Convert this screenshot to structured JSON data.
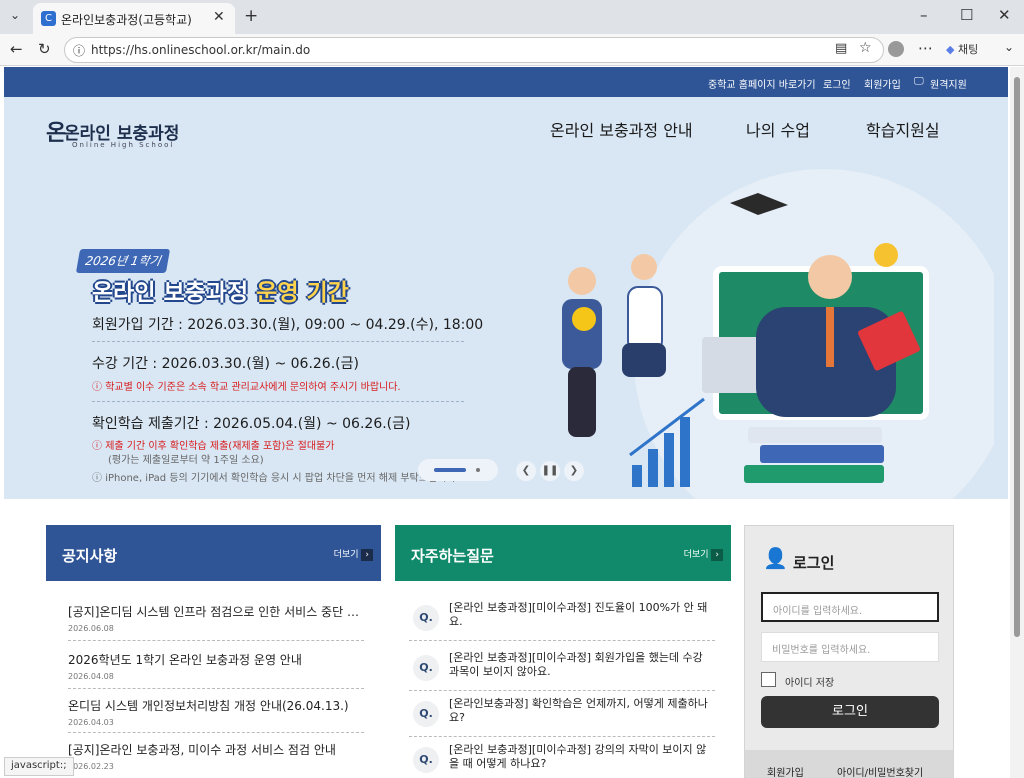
{
  "browser": {
    "tab_title": "온라인보충과정(고등학교)",
    "url": "https://hs.onlineschool.or.kr/main.do",
    "copilot_label": "채팅"
  },
  "topbar": {
    "links": [
      "중학교 홈페이지 바로가기",
      "로그인",
      "회원가입",
      "원격지원"
    ]
  },
  "header": {
    "logo_main": "온라인 보충과정",
    "logo_sub": "Online High School",
    "menu": [
      "온라인 보충과정 안내",
      "나의 수업",
      "학습지원실"
    ]
  },
  "hero": {
    "badge": "2026년 1학기",
    "title_a": "온라인 보충과정",
    "title_b": "운영 기간",
    "signup": "회원가입 기간 : 2026.03.30.(월), 09:00 ~ 04.29.(수), 18:00",
    "course": "수강 기간 : 2026.03.30.(월) ~ 06.26.(금)",
    "course_note": "학교별 이수 기준은 소속 학교 관리교사에게 문의하여 주시기 바랍니다.",
    "check": "확인학습 제출기간 : 2026.05.04.(월) ~ 06.26.(금)",
    "check_note": "제출 기간 이후 확인학습 제출(재제출 포함)은 절대불가",
    "check_note2": "(평가는 제출일로부터 약 1주일 소요)",
    "ios_note": "iPhone, iPad 등의 기기에서 확인학습 응시 시 팝업 차단을 먼저 해제 부탁드립니다."
  },
  "notice": {
    "title": "공지사항",
    "more": "더보기",
    "items": [
      {
        "title": "[공지]온디딤 시스템 인프라 점검으로 인한 서비스 중단 …",
        "date": "2026.06.08"
      },
      {
        "title": "2026학년도 1학기 온라인 보충과정 운영 안내",
        "date": "2026.04.08"
      },
      {
        "title": "온디딤 시스템 개인정보처리방침 개정 안내(26.04.13.)",
        "date": "2026.04.03"
      },
      {
        "title": "[공지]온라인 보충과정, 미이수 과정 서비스 점검 안내",
        "date": "2026.02.23"
      }
    ]
  },
  "faq": {
    "title": "자주하는질문",
    "more": "더보기",
    "q": "Q.",
    "items": [
      "[온라인 보충과정][미이수과정] 진도율이 100%가 안 돼요.",
      "[온라인 보충과정][미이수과정] 회원가입을 했는데 수강 과목이 보이지 않아요.",
      "[온라인보충과정] 확인학습은 언제까지, 어떻게 제출하나요?",
      "[온라인 보충과정][미이수과정] 강의의 자막이 보이지 않을 때 어떻게 하나요?"
    ]
  },
  "login": {
    "title": "로그인",
    "id_placeholder": "아이디를 입력하세요.",
    "pw_placeholder": "비밀번호를 입력하세요.",
    "save": "아이디 저장",
    "button": "로그인",
    "join": "회원가입",
    "find": "아이디/비밀번호찾기"
  },
  "status_text": "javascript:;"
}
